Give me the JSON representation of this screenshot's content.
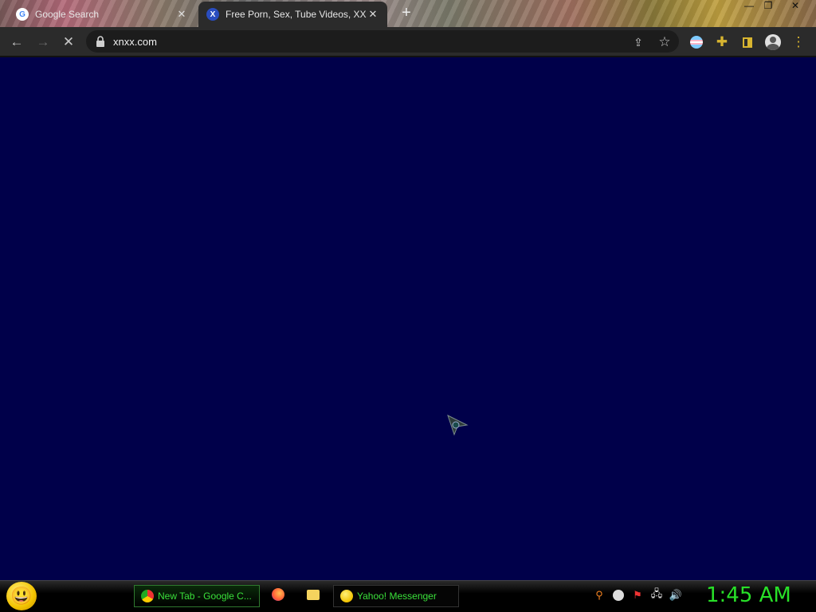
{
  "browser": {
    "tabs": [
      {
        "title": "Google Search",
        "favicon": "google-icon",
        "active": false
      },
      {
        "title": "Free Porn, Sex, Tube Videos, XXX",
        "favicon": "xnxx-icon",
        "active": true
      }
    ],
    "new_tab_symbol": "+",
    "window_controls": {
      "minimize": "—",
      "restore": "❐",
      "close": "✕"
    },
    "address": {
      "url": "xnxx.com",
      "secure": true
    },
    "nav": {
      "back": "←",
      "forward": "→",
      "stop": "✕"
    }
  },
  "taskbar": {
    "start_icon": "yahoo-smiley-icon",
    "items": [
      {
        "label": "New Tab - Google C...",
        "icon": "chrome-icon"
      },
      {
        "label": "Yahoo! Messenger",
        "icon": "yahoo-messenger-icon"
      }
    ],
    "clock": "1:45 AM"
  },
  "colors": {
    "page_background": "#00004a",
    "toolbar": "#2b2b2b",
    "taskbar_text": "#3ae03a"
  }
}
